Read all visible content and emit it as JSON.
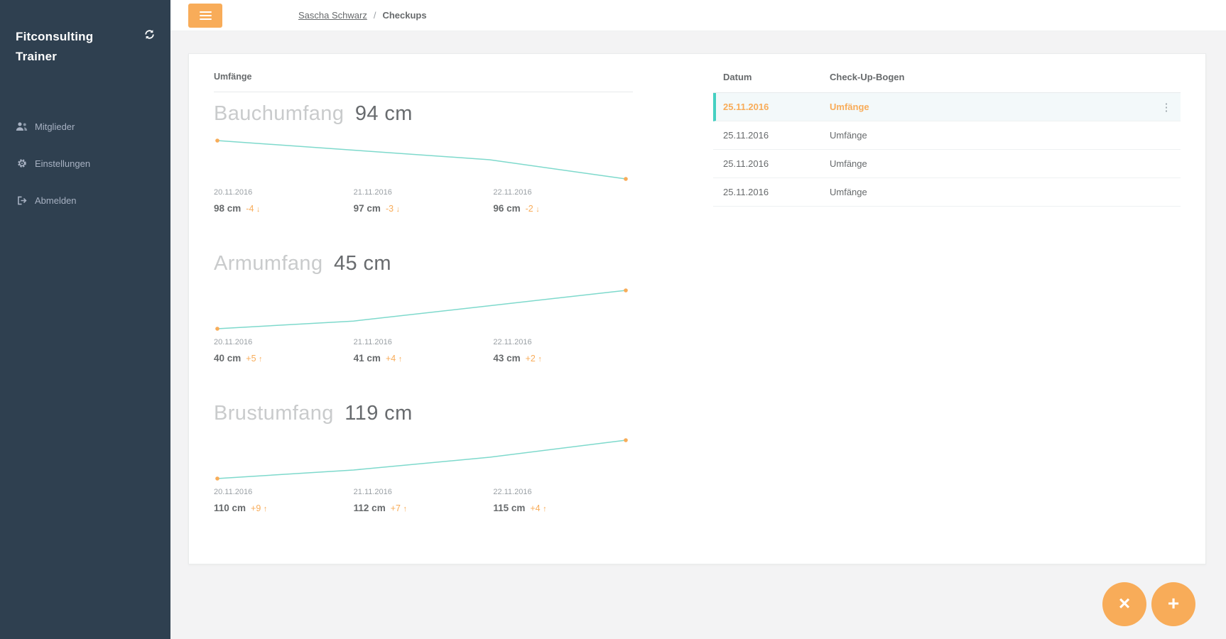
{
  "app": {
    "accent_orange": "#f8ac59",
    "teal": "#45d0c2",
    "sidebar_bg": "#2f4050",
    "page_bg": "#f3f3f4"
  },
  "sidebar": {
    "brand": "Fitconsulting Trainer",
    "refresh_icon": "refresh-icon",
    "items": [
      {
        "label": "Mitglieder",
        "icon": "users-icon"
      },
      {
        "label": "Einstellungen",
        "icon": "gears-icon"
      },
      {
        "label": "Abmelden",
        "icon": "sign-out-icon"
      }
    ]
  },
  "topbar": {
    "menu_icon": "hamburger-icon",
    "breadcrumb": {
      "parent": "Sascha Schwarz",
      "separator": "/",
      "current": "Checkups"
    }
  },
  "panel": {
    "title": "Umfänge"
  },
  "chart_data": [
    {
      "type": "line",
      "title": "Bauchumfang",
      "current_value_label": "94 cm",
      "unit": "cm",
      "x": [
        "20.11.2016",
        "21.11.2016",
        "22.11.2016"
      ],
      "values": [
        98,
        97,
        96
      ],
      "latest_value": 94,
      "ylim": [
        94,
        98
      ],
      "trend": "down",
      "line_color": "#5ecfbf",
      "point_color": "#f8ac59",
      "points": [
        {
          "date": "20.11.2016",
          "value_label": "98 cm",
          "delta": "-4",
          "arrow": "↓"
        },
        {
          "date": "21.11.2016",
          "value_label": "97 cm",
          "delta": "-3",
          "arrow": "↓"
        },
        {
          "date": "22.11.2016",
          "value_label": "96 cm",
          "delta": "-2",
          "arrow": "↓"
        }
      ]
    },
    {
      "type": "line",
      "title": "Armumfang",
      "current_value_label": "45 cm",
      "unit": "cm",
      "x": [
        "20.11.2016",
        "21.11.2016",
        "22.11.2016"
      ],
      "values": [
        40,
        41,
        43
      ],
      "latest_value": 45,
      "ylim": [
        40,
        45
      ],
      "trend": "up",
      "line_color": "#5ecfbf",
      "point_color": "#f8ac59",
      "points": [
        {
          "date": "20.11.2016",
          "value_label": "40 cm",
          "delta": "+5",
          "arrow": "↑"
        },
        {
          "date": "21.11.2016",
          "value_label": "41 cm",
          "delta": "+4",
          "arrow": "↑"
        },
        {
          "date": "22.11.2016",
          "value_label": "43 cm",
          "delta": "+2",
          "arrow": "↑"
        }
      ]
    },
    {
      "type": "line",
      "title": "Brustumfang",
      "current_value_label": "119 cm",
      "unit": "cm",
      "x": [
        "20.11.2016",
        "21.11.2016",
        "22.11.2016"
      ],
      "values": [
        110,
        112,
        115
      ],
      "latest_value": 119,
      "ylim": [
        110,
        119
      ],
      "trend": "up",
      "line_color": "#5ecfbf",
      "point_color": "#f8ac59",
      "points": [
        {
          "date": "20.11.2016",
          "value_label": "110 cm",
          "delta": "+9",
          "arrow": "↑"
        },
        {
          "date": "21.11.2016",
          "value_label": "112 cm",
          "delta": "+7",
          "arrow": "↑"
        },
        {
          "date": "22.11.2016",
          "value_label": "115 cm",
          "delta": "+4",
          "arrow": "↑"
        }
      ]
    }
  ],
  "table": {
    "columns": [
      "Datum",
      "Check-Up-Bogen"
    ],
    "row_menu_glyph": "⋮",
    "rows": [
      {
        "date": "25.11.2016",
        "type": "Umfänge",
        "selected": true
      },
      {
        "date": "25.11.2016",
        "type": "Umfänge",
        "selected": false
      },
      {
        "date": "25.11.2016",
        "type": "Umfänge",
        "selected": false
      },
      {
        "date": "25.11.2016",
        "type": "Umfänge",
        "selected": false
      }
    ]
  },
  "fabs": [
    {
      "glyph": "×",
      "name": "close-button"
    },
    {
      "glyph": "+",
      "name": "add-button"
    }
  ]
}
